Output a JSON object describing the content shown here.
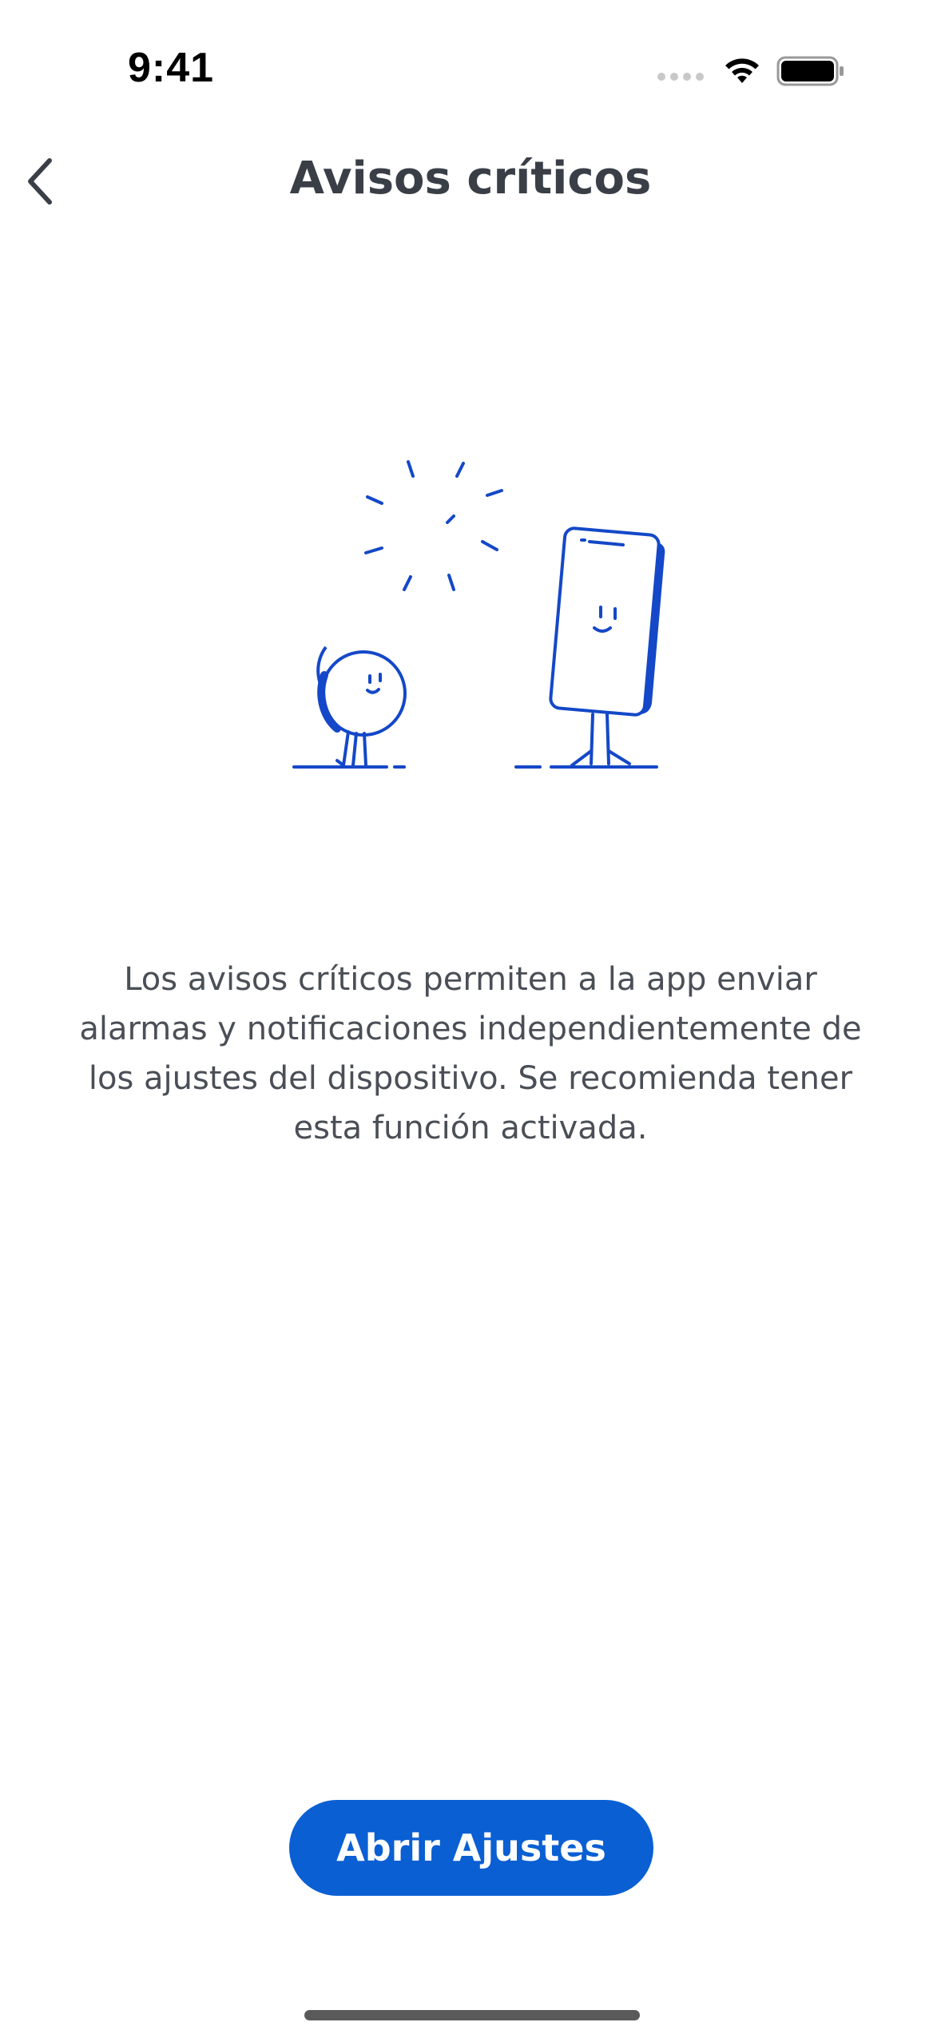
{
  "status_bar": {
    "time": "9:41"
  },
  "nav": {
    "title": "Avisos críticos",
    "back_icon": "chevron-left-icon"
  },
  "illustration": {
    "name": "critical-alerts-illustration",
    "accent_color": "#1448c8"
  },
  "description": "Los avisos críticos permiten a la app enviar alarmas y notificaciones independientemente de los ajustes del dispositivo. Se recomienda tener esta función activada.",
  "actions": {
    "open_settings_label": "Abrir Ajustes"
  },
  "colors": {
    "primary_button": "#0a5fd3",
    "text": "#4a4f57",
    "title": "#3a3f47"
  }
}
